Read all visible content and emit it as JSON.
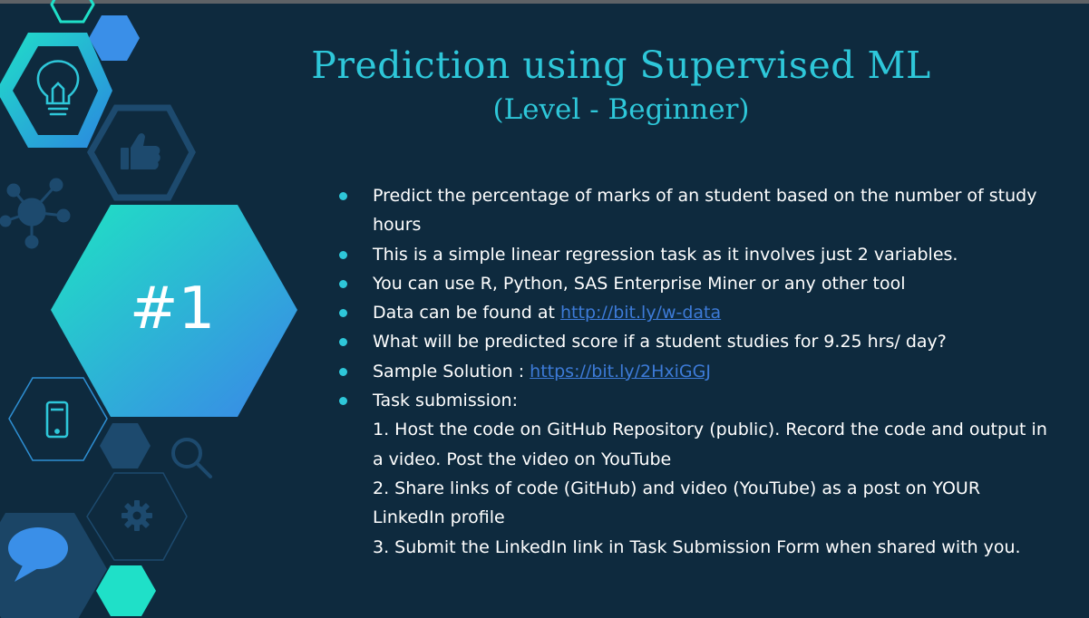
{
  "slide": {
    "title": "Prediction using Supervised ML",
    "subtitle": "(Level - Beginner)",
    "badge": "#1"
  },
  "bullets": {
    "b1": "Predict the percentage of marks of an student based on the number of study hours",
    "b2": "This is a simple linear  regression task as it involves just 2 variables.",
    "b3": "You can use R, Python, SAS Enterprise Miner or any other tool",
    "b4_text": "Data can be found at ",
    "b4_link": "http://bit.ly/w-data",
    "b5": "What will be predicted score if a student studies for 9.25 hrs/ day?",
    "b6_text": "Sample Solution : ",
    "b6_link": "https://bit.ly/2HxiGGJ",
    "b7": "Task submission:",
    "steps": [
      "1. Host the code on GitHub Repository (public). Record the code and output in a video. Post the video on YouTube",
      "2. Share links of code (GitHub) and video (YouTube) as a post on YOUR LinkedIn profile",
      "3. Submit the LinkedIn link in Task Submission Form when shared with you."
    ]
  },
  "icons": [
    "lightbulb-icon",
    "thumbs-up-icon",
    "network-icon",
    "smartphone-icon",
    "magnifier-icon",
    "gear-icon",
    "speech-bubble-icon"
  ],
  "colors": {
    "background": "#0e2a3e",
    "accent": "#2ec7d9",
    "link": "#3d7bd8",
    "hex_blue": "#3a8fe8",
    "hex_teal": "#1fe0c8",
    "hex_outline": "#1d4a6e"
  }
}
